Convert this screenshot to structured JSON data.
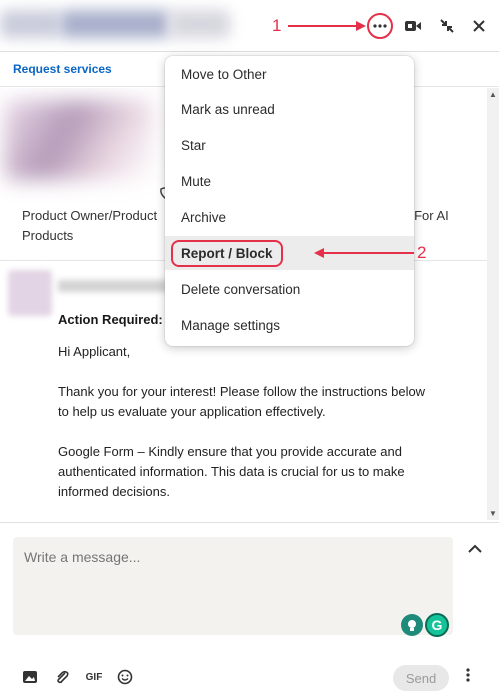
{
  "header": {
    "icons": [
      "more-icon",
      "video-icon",
      "minimize-icon",
      "close-icon"
    ],
    "annotation_1": "1",
    "annotation_2": "2"
  },
  "subheader": {
    "request_link": "Request services"
  },
  "conversation": {
    "profile_headline": "Product Owner/Product",
    "profile_headline_suffix": "ect For AI",
    "profile_headline_line2": "Products",
    "message": {
      "subject": "Action Required:",
      "greeting": "Hi Applicant,",
      "paragraph1": "Thank you for your interest! Please follow the instructions below to help us evaluate your application effectively.",
      "paragraph2": "Google Form – Kindly ensure that you provide accurate and authenticated information. This data is crucial for us to make informed decisions."
    }
  },
  "menu": {
    "items": [
      {
        "label": "Move to Other"
      },
      {
        "label": "Mark as unread"
      },
      {
        "label": "Star"
      },
      {
        "label": "Mute"
      },
      {
        "label": "Archive"
      },
      {
        "label": "Report / Block"
      },
      {
        "label": "Delete conversation"
      },
      {
        "label": "Manage settings"
      }
    ]
  },
  "compose": {
    "placeholder": "Write a message...",
    "gif_label": "GIF",
    "send_label": "Send"
  },
  "colors": {
    "accent_link": "#0a66c2",
    "annotation": "#e5304a",
    "grammarly": "#15c39a"
  }
}
